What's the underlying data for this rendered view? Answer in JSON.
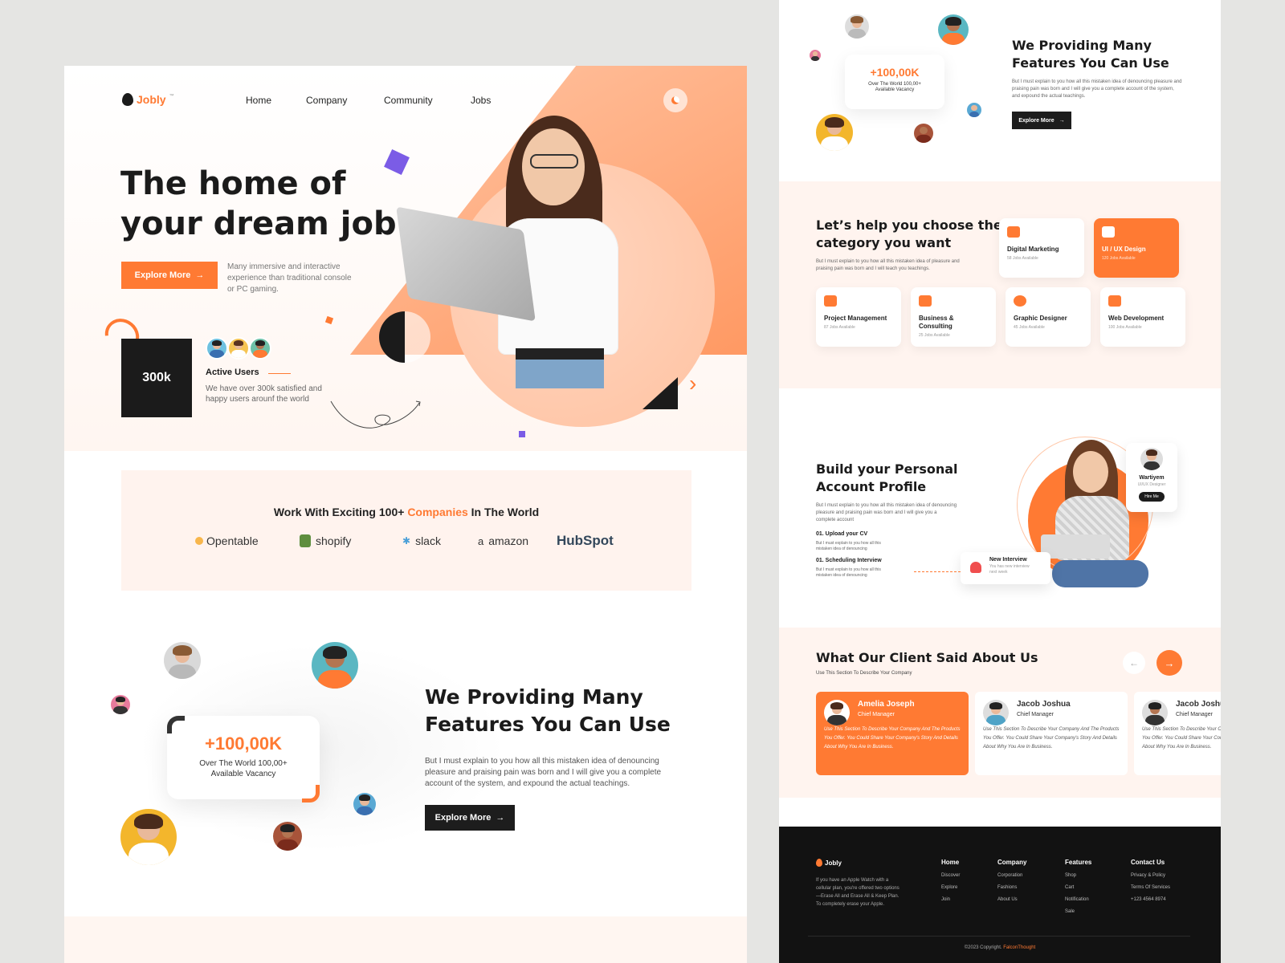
{
  "brand": {
    "name": "Jobly",
    "tm": "™",
    "accent": "#ff7a33",
    "dark": "#1d1d1d"
  },
  "nav": {
    "items": [
      "Home",
      "Company",
      "Community",
      "Jobs"
    ]
  },
  "hero": {
    "title_line1": "The home of",
    "title_line2": "your dream job",
    "button": "Explore More",
    "description": "Many immersive and interactive experience than traditional console or PC gaming."
  },
  "stats": {
    "value": "300k",
    "label": "Active Users",
    "description": "We have over 300k satisfied and happy users arounf the world"
  },
  "partners": {
    "heading_pre": "Work With Exciting 100+ ",
    "heading_highlight": "Companies",
    "heading_post": " In The World",
    "logos": [
      "Opentable",
      "shopify",
      "slack",
      "amazon",
      "HubSpot"
    ]
  },
  "features": {
    "title_line1": "We Providing Many",
    "title_line2": "Features You Can Use",
    "description": "But I must explain to you how all this mistaken idea of denouncing pleasure and praising pain was born and I will give you a complete account of the system, and expound the actual teachings.",
    "button": "Explore More",
    "card_value": "+100,00K",
    "card_text_line1": "Over The World 100,00+",
    "card_text_line2": "Available Vacancy"
  },
  "categories": {
    "title_line1": "Let’s help you choose the",
    "title_line2": "category you want",
    "description": "But I must explain to you how all this mistaken idea of pleasure and praising pain was born and I will teach you teachings.",
    "items": [
      {
        "name": "Digital Marketing",
        "jobs": "58 Jobs Available"
      },
      {
        "name": "UI / UX Design",
        "jobs": "120 Jobs Available"
      },
      {
        "name": "Project Management",
        "jobs": "87 Jobs Available"
      },
      {
        "name": "Business & Consulting",
        "jobs": "25 Jobs Available"
      },
      {
        "name": "Graphic Designer",
        "jobs": "45 Jobs Available"
      },
      {
        "name": "Web Development",
        "jobs": "100 Jobs Available"
      }
    ]
  },
  "profile": {
    "title_line1": "Build your Personal",
    "title_line2": "Account Profile",
    "description": "But I must explain to you how all this mistaken idea of denouncing pleasure and praising pain was born and I will give you a complete account",
    "step1_title": "01. Upload your CV",
    "step1_text": "But I must explain to you how all this mistaken idea of denouncing",
    "step2_title": "01. Scheduling Interview",
    "step2_text": "But I must explain to you how all this mistaken idea of denouncing",
    "card_name": "Wartiyem",
    "card_role": "UI/UX Designer",
    "card_button": "Hire Me",
    "notice_title": "New Interview",
    "notice_text": "You has new interview next week"
  },
  "testimonials": {
    "title": "What Our Client Said About Us",
    "subtitle": "Use This Section To Describe Your Company",
    "items": [
      {
        "name": "Amelia Joseph",
        "role": "Chief Manager",
        "text": "Use This Section To Describe Your Company And The Products You Offer. You Could Share Your Company's Story And Details About Why You Are In Business."
      },
      {
        "name": "Jacob Joshua",
        "role": "Chief Manager",
        "text": "Use This Section To Describe Your Company And The Products You Offer. You Could Share Your Company's Story And Details About Why You Are In Business."
      },
      {
        "name": "Jacob Joshua",
        "role": "Chief Manager",
        "text": "Use This Section To Describe Your Company And The Products You Offer. You Could Share Your Company's Story And Details About Why You Are In Business."
      }
    ]
  },
  "footer": {
    "brand": "Jobly",
    "about": "If you have an Apple Watch with a cellular plan, you're offered two options—Erase All and Erase All & Keep Plan. To completely erase your Apple.",
    "col1": {
      "title": "Home",
      "links": [
        "Discover",
        "Explore",
        "Join"
      ]
    },
    "col2": {
      "title": "Company",
      "links": [
        "Corporation",
        "Fashions",
        "About Us"
      ]
    },
    "col3": {
      "title": "Features",
      "links": [
        "Shop",
        "Cart",
        "Notification",
        "Sale"
      ]
    },
    "col4": {
      "title": "Contact Us",
      "links": [
        "Privacy & Policy",
        "Terms Of Services",
        "+123 4564 8974"
      ]
    },
    "copyright_pre": "©2023 Copyright. ",
    "copyright_brand": "FalconThought"
  }
}
